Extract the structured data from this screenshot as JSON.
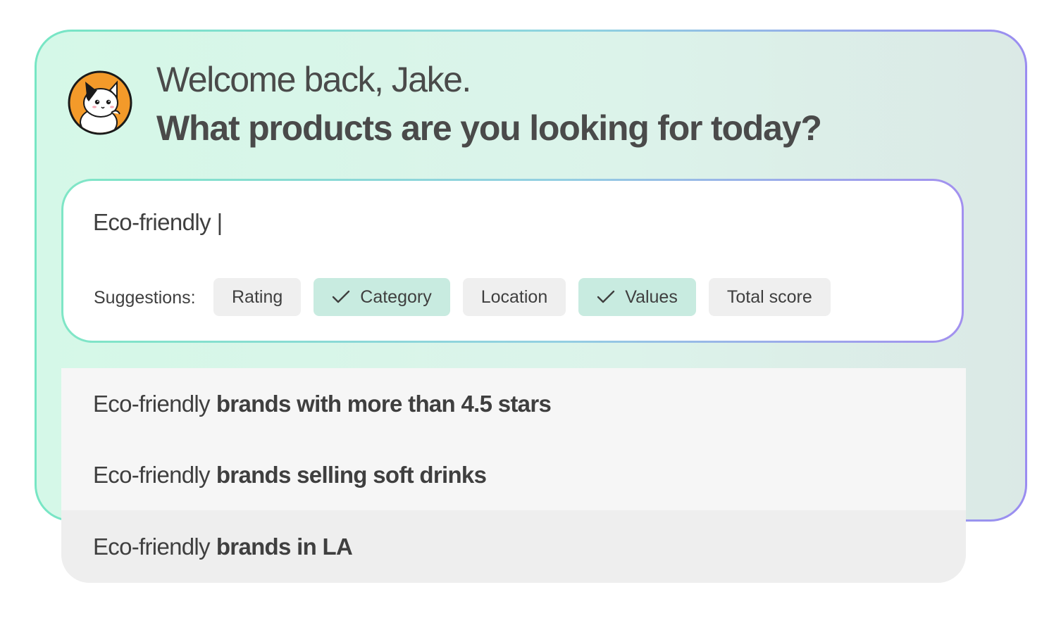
{
  "header": {
    "greeting": "Welcome back, Jake.",
    "question": "What products are you looking for today?"
  },
  "search": {
    "value": "Eco-friendly |",
    "placeholder": ""
  },
  "suggestions": {
    "label": "Suggestions:",
    "chips": [
      {
        "label": "Rating",
        "selected": false
      },
      {
        "label": "Category",
        "selected": true
      },
      {
        "label": "Location",
        "selected": false
      },
      {
        "label": "Values",
        "selected": true
      },
      {
        "label": "Total score",
        "selected": false
      }
    ]
  },
  "results": [
    {
      "prefix": "Eco-friendly",
      "rest": "brands with more than 4.5 stars"
    },
    {
      "prefix": "Eco-friendly",
      "rest": "brands selling soft drinks"
    },
    {
      "prefix": "Eco-friendly",
      "rest": "brands in LA"
    }
  ],
  "colors": {
    "accent_green": "#77e6c4",
    "accent_purple": "#9a8cf0",
    "chip_selected": "#c8ebe0",
    "avatar_orange": "#f39a2a"
  },
  "icons": {
    "avatar": "cat-avatar-icon",
    "chip_check": "check-icon"
  }
}
